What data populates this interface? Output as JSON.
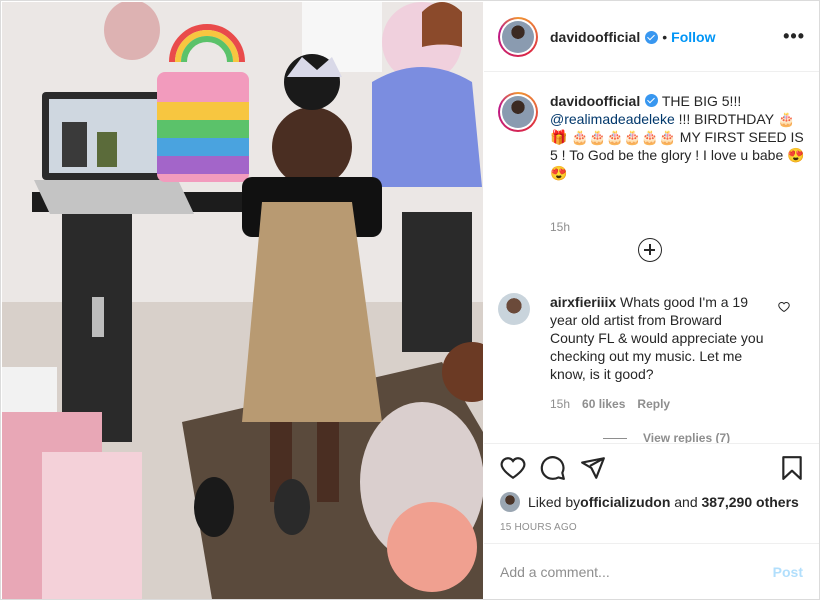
{
  "post": {
    "username": "davidoofficial",
    "follow_label": "Follow",
    "more_label": "•••",
    "dot": "•"
  },
  "caption": {
    "username": "davidoofficial",
    "text_1": " THE BIG 5!!! ",
    "mention": "@realimadeadeleke",
    "text_2": " !!! BIRDTHDAY 🎂 🎁 🎂🎂🎂🎂🎂🎂 MY FIRST SEED IS 5 ! To God be the glory ! I love u babe 😍 😍",
    "time": "15h"
  },
  "comment": {
    "username": "airxfieriiix",
    "text": " Whats good I'm a 19 year old artist from Broward County FL & would appreciate you checking out my music. Let me know, is it good?",
    "time": "15h",
    "likes": "60 likes",
    "reply": "Reply",
    "view_replies": "View replies (7)"
  },
  "likes": {
    "prefix": "Liked by ",
    "user": "officializudon",
    "middle": " and ",
    "count": "387,290 others",
    "timestamp": "15 HOURS AGO"
  },
  "composer": {
    "placeholder": "Add a comment...",
    "post_label": "Post"
  },
  "colors": {
    "accent": "#0095f6",
    "verified": "#3897f0",
    "post_disabled": "#b2dffc",
    "muted": "#8e8e8e"
  }
}
